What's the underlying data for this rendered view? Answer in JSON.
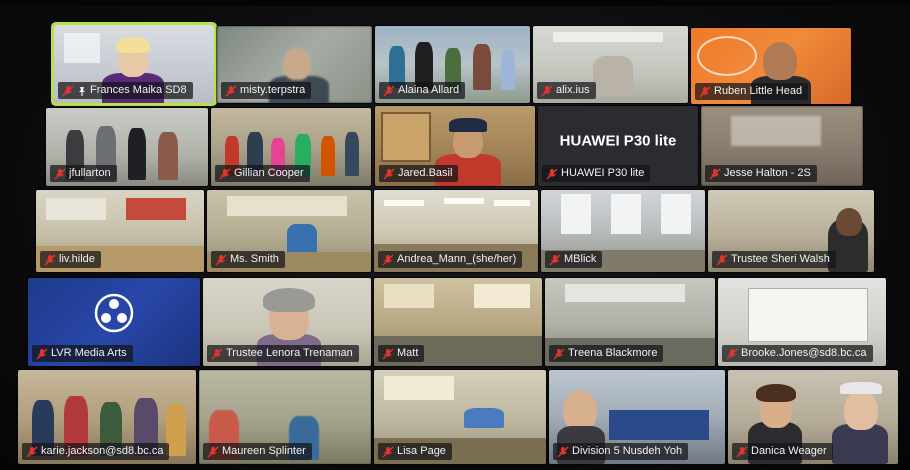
{
  "app": {
    "name": "Video conference gallery view"
  },
  "participants": [
    {
      "name": "Frances Maika SD8",
      "muted": true,
      "pinned": true,
      "active": true
    },
    {
      "name": "misty.terpstra",
      "muted": true
    },
    {
      "name": "Alaina Allard",
      "muted": true
    },
    {
      "name": "alix.ius",
      "muted": true
    },
    {
      "name": "Ruben Little Head",
      "muted": true
    },
    {
      "name": "jfullarton",
      "muted": true
    },
    {
      "name": "Gillian Cooper",
      "muted": true
    },
    {
      "name": "Jared.Basil",
      "muted": true
    },
    {
      "name": "HUAWEI P30 lite",
      "muted": true,
      "video_off_text": "HUAWEI P30 lite"
    },
    {
      "name": "Jesse Halton - 2S",
      "muted": true
    },
    {
      "name": "liv.hilde",
      "muted": true
    },
    {
      "name": "Ms. Smith",
      "muted": true
    },
    {
      "name": "Andrea_Mann_(she/her)",
      "muted": true
    },
    {
      "name": "MBlick",
      "muted": true
    },
    {
      "name": "Trustee Sheri Walsh",
      "muted": true
    },
    {
      "name": "LVR Media Arts",
      "muted": true
    },
    {
      "name": "Trustee Lenora Trenaman",
      "muted": true
    },
    {
      "name": "Matt",
      "muted": true
    },
    {
      "name": "Treena Blackmore",
      "muted": true
    },
    {
      "name": "Brooke.Jones@sd8.bc.ca",
      "muted": true
    },
    {
      "name": "karie.jackson@sd8.bc.ca",
      "muted": true
    },
    {
      "name": "Maureen Splinter",
      "muted": true
    },
    {
      "name": "Lisa Page",
      "muted": true
    },
    {
      "name": "Division 5 Nusdeh Yoh",
      "muted": true
    },
    {
      "name": "Danica Weager",
      "muted": true
    }
  ],
  "colors": {
    "active_speaker_border": "#b7e04a",
    "muted_icon": "#e0342c",
    "label_bg": "#141418"
  }
}
